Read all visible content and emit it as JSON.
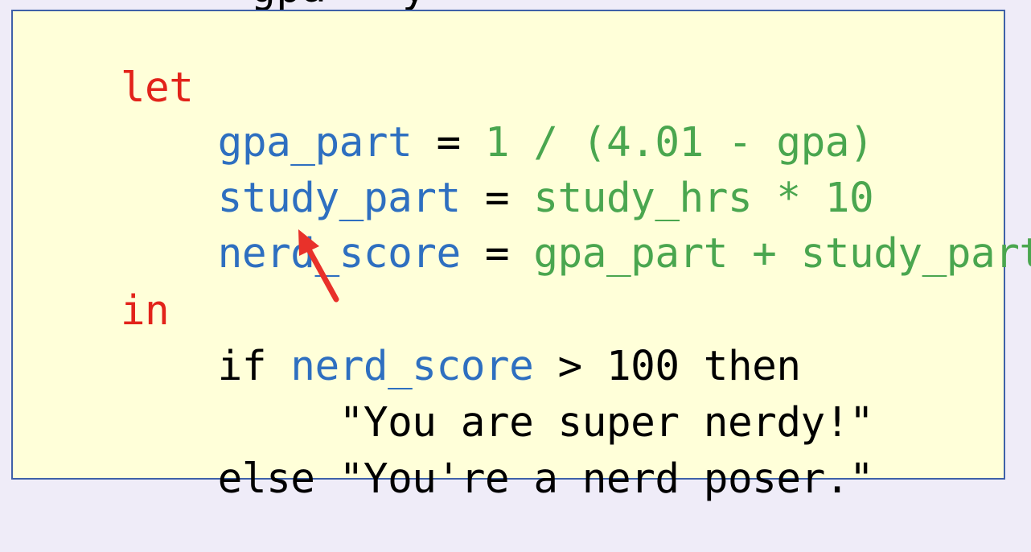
{
  "clipped_top_line": "_  _  _  gpa   y_",
  "code": {
    "line1": {
      "kw": "let"
    },
    "line2": {
      "indent": "    ",
      "var": "gpa_part",
      "op": " = ",
      "expr": "1 / (4.01 - gpa)"
    },
    "line3": {
      "indent": "    ",
      "var": "study_part",
      "op": " = ",
      "expr": "study_hrs * 10"
    },
    "line4": {
      "indent": "    ",
      "var": "nerd_score",
      "op": " = ",
      "expr": "gpa_part + study_part"
    },
    "line5": {
      "kw": "in"
    },
    "line6": {
      "indent": "    ",
      "kw_if": "if ",
      "var": "nerd_score",
      "rest": " > 100 then"
    },
    "line7": {
      "indent": "         ",
      "text": "\"You are super nerdy!\""
    },
    "line8": {
      "indent": "    ",
      "text": "else \"You're a nerd poser.\""
    }
  },
  "colors": {
    "keyword": "#e2231a",
    "variable": "#2e6fc0",
    "expression": "#4aa64f",
    "box_background": "#ffffd9",
    "box_border": "#3f61a8",
    "arrow": "#e8312a"
  },
  "icons": {
    "annotation": "red-arrow-icon"
  }
}
